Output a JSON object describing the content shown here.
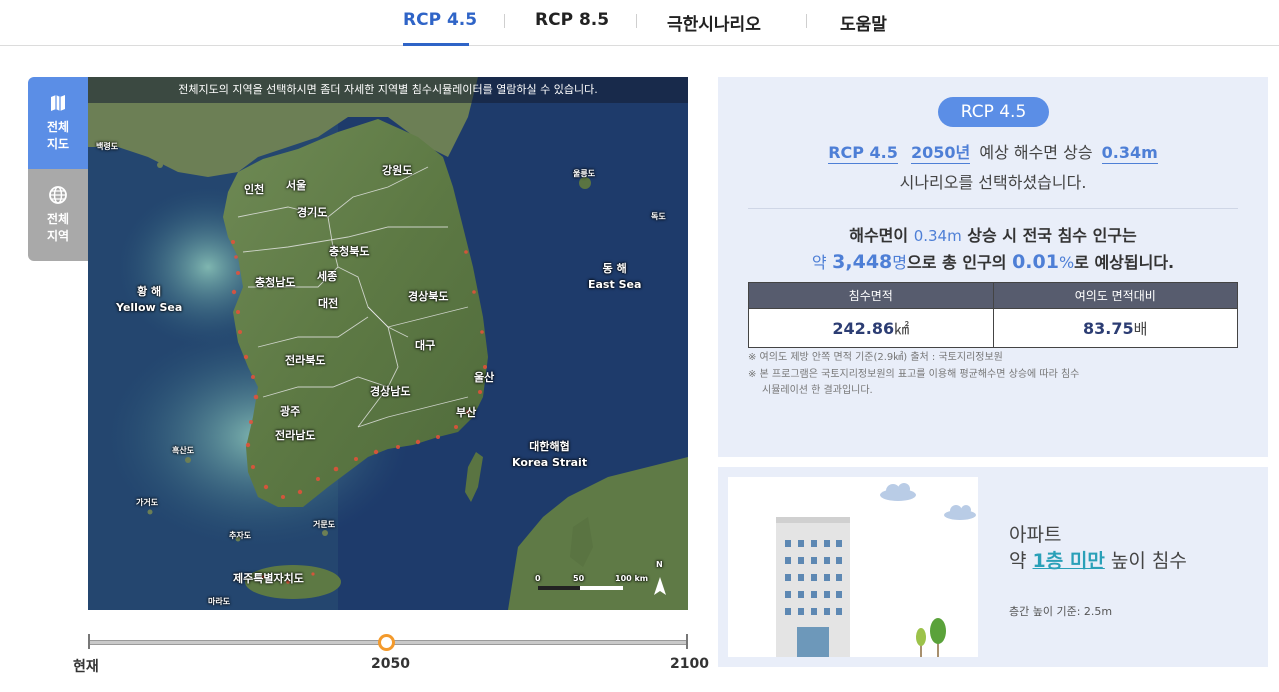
{
  "nav": {
    "tabs": [
      {
        "label": "RCP 4.5",
        "active": true
      },
      {
        "label": "RCP 8.5",
        "active": false
      },
      {
        "label": "극한시나리오",
        "active": false
      },
      {
        "label": "도움말",
        "active": false
      }
    ]
  },
  "sidebar": {
    "items": [
      {
        "label_line1": "전체",
        "label_line2": "지도",
        "icon": "map-icon",
        "active": true
      },
      {
        "label_line1": "전체",
        "label_line2": "지역",
        "icon": "globe-icon",
        "active": false
      }
    ]
  },
  "map": {
    "notice": "전체지도의 지역을 선택하시면 좀더 자세한 지역별 침수시뮬레이터를 열람하실 수 있습니다.",
    "labels": {
      "baengnyeongdo": "백령도",
      "incheon": "인천",
      "seoul": "서울",
      "gyeonggido": "경기도",
      "gangwondo": "강원도",
      "ulleungdo": "울릉도",
      "dokdo": "독도",
      "chungbuk": "충청북도",
      "chungnam": "충청남도",
      "sejong": "세종",
      "daejeon": "대전",
      "gyeongbuk": "경상북도",
      "jeonbuk": "전라북도",
      "daegu": "대구",
      "ulsan": "울산",
      "gyeongnam": "경상남도",
      "busan": "부산",
      "gwangju": "광주",
      "jeonnam": "전라남도",
      "heuksando": "흑산도",
      "gageodo": "가거도",
      "chujado": "추자도",
      "geomundo": "거문도",
      "jeju": "제주특별자치도",
      "marado": "마라도",
      "yellow_sea_ko": "황 해",
      "yellow_sea_en": "Yellow Sea",
      "east_sea_ko": "동 해",
      "east_sea_en": "East Sea",
      "korea_strait_ko": "대한해협",
      "korea_strait_en": "Korea Strait"
    },
    "scale": {
      "t0": "0",
      "t1": "50",
      "t2": "100 km"
    },
    "north": "N"
  },
  "slider": {
    "labels": [
      "현재",
      "2050",
      "2100"
    ],
    "selected": "2050",
    "position_fraction": 0.5
  },
  "info": {
    "badge": "RCP 4.5",
    "scenario": "RCP 4.5",
    "year": "2050년",
    "middle_text": "예상 해수면 상승",
    "rise": "0.34m",
    "line2": "시나리오를 선택하셨습니다.",
    "summary_pre": "해수면이",
    "summary_rise": "0.34m",
    "summary_post": "상승 시 전국 침수 인구는",
    "approx": "약",
    "population": "3,448",
    "pop_unit": "명",
    "pop_mid": "으로 총 인구의",
    "ratio": "0.01",
    "ratio_unit": "%",
    "ratio_post": "로 예상됩니다.",
    "table": {
      "headers": [
        "침수면적",
        "여의도 면적대비"
      ],
      "area_value": "242.86",
      "area_unit": "㎢",
      "ratio_value": "83.75",
      "ratio_unit": "배"
    },
    "notes": [
      "※ 여의도 제방 안쪽 면적 기준(2.9㎢) 출처 : 국토지리정보원",
      "※ 본 프로그램은 국토지리정보원의 표고를 이용해 평균해수면 상승에 따라 침수",
      "시뮬레이션 한 결과입니다."
    ]
  },
  "building": {
    "type": "아파트",
    "approx": "약",
    "floors": "1층 미만",
    "post": "높이 침수",
    "note": "층간 높이 기준: 2.5m"
  },
  "colors": {
    "accent": "#2f64c7",
    "pill": "#5b8ee6",
    "panel_bg": "#e9eef9",
    "slider_thumb": "#f39a2c",
    "flood_highlight": "#e8503a"
  }
}
